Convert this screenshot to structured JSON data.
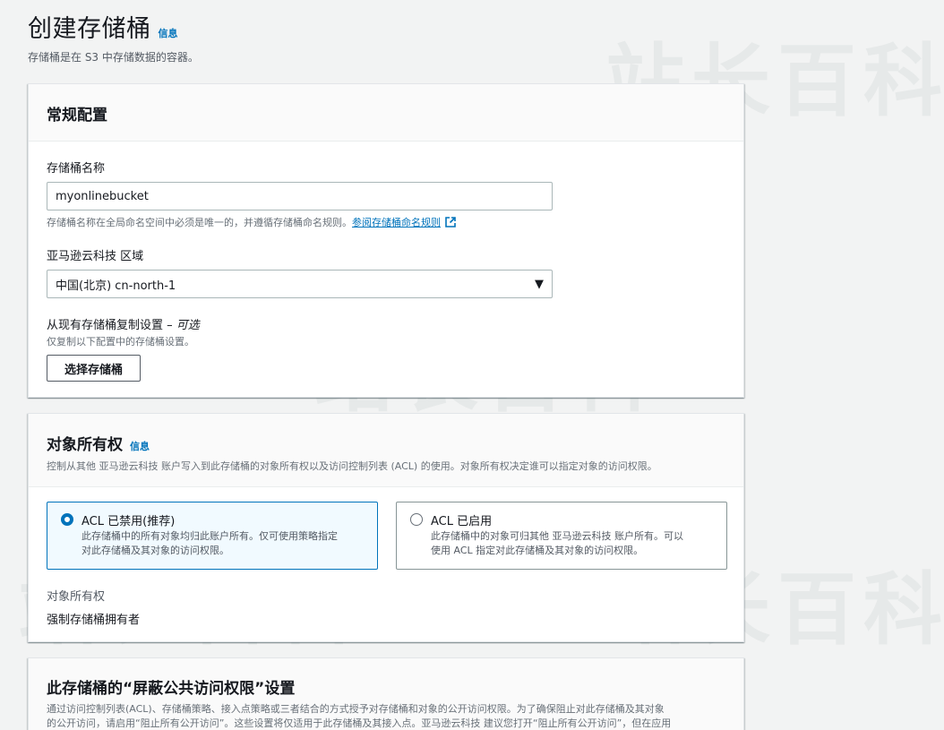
{
  "page": {
    "title": "创建存储桶",
    "info_label": "信息",
    "description": "存储桶是在 S3 中存储数据的容器。"
  },
  "general": {
    "title": "常规配置",
    "bucket_name_label": "存储桶名称",
    "bucket_name_value": "myonlinebucket",
    "bucket_name_hint": "存储桶名称在全局命名空间中必须是唯一的，并遵循存储桶命名规则。",
    "naming_rules_link": "参阅存储桶命名规则",
    "region_label": "亚马逊云科技 区域",
    "region_value": "中国(北京) cn-north-1",
    "copy_label": "从现有存储桶复制设置 –",
    "copy_optional": "可选",
    "copy_hint": "仅复制以下配置中的存储桶设置。",
    "choose_button": "选择存储桶"
  },
  "ownership": {
    "title": "对象所有权",
    "info_label": "信息",
    "description": "控制从其他 亚马逊云科技 账户写入到此存储桶的对象所有权以及访问控制列表 (ACL) 的使用。对象所有权决定谁可以指定对象的访问权限。",
    "options": [
      {
        "title": "ACL 已禁用(推荐)",
        "desc_line1": "此存储桶中的所有对象均归此账户所有。仅可使用策略指定",
        "desc_line2": "对此存储桶及其对象的访问权限。",
        "selected": true
      },
      {
        "title": "ACL 已启用",
        "desc_line1": "此存储桶中的对象可归其他 亚马逊云科技 账户所有。可以",
        "desc_line2": "使用 ACL 指定对此存储桶及其对象的访问权限。",
        "selected": false
      }
    ],
    "owner_label": "对象所有权",
    "owner_value": "强制存储桶拥有者"
  },
  "block_public": {
    "title": "此存储桶的“屏蔽公共访问权限”设置",
    "line1": "通过访问控制列表(ACL)、存储桶策略、接入点策略或三者结合的方式授予对存储桶和对象的公开访问权限。为了确保阻止对此存储桶及其对象",
    "line2": "的公开访问，请启用“阻止所有公开访问”。这些设置将仅适用于此存储桶及其接入点。亚马逊云科技 建议您打开“阻止所有公开访问”，但在应用"
  },
  "watermark": {
    "text": "站长百科"
  },
  "colors": {
    "accent": "#0073bb",
    "page_bg": "#f2f3f3",
    "selected_tile_bg": "#f1faff"
  },
  "icons": {
    "external_link": "external-link-icon",
    "dropdown": "caret-down-icon"
  }
}
